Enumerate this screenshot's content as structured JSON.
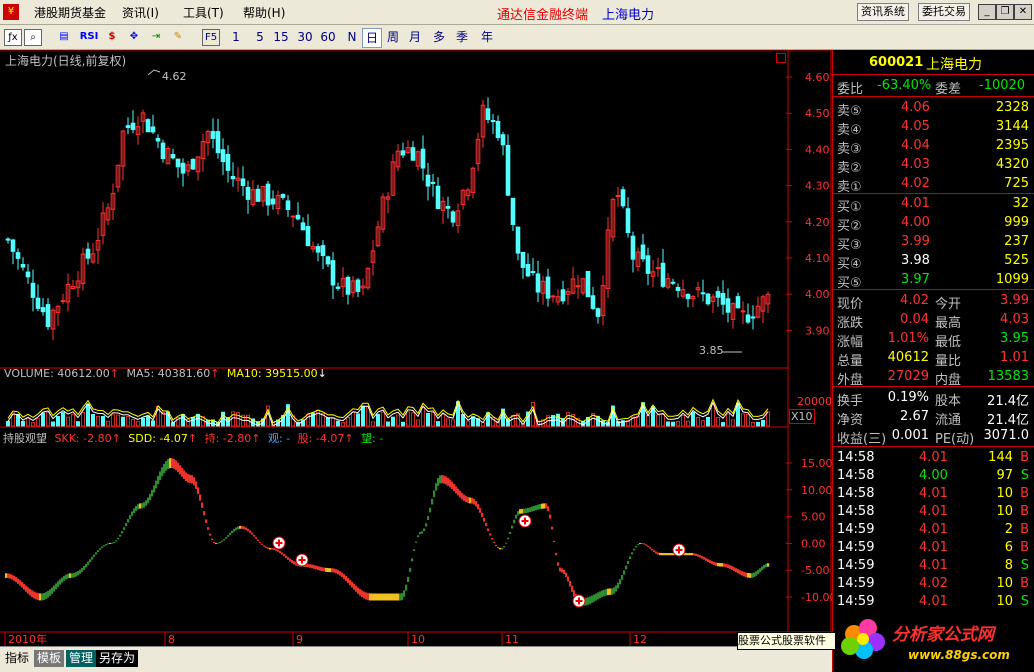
{
  "menu": {
    "items": [
      "港股期货基金",
      "资讯(I)",
      "工具(T)",
      "帮助(H)"
    ],
    "headline": "通达信金融终端",
    "headline_stock": "上海电力",
    "btn_news": "资讯系统",
    "btn_trade": "委托交易"
  },
  "toolbar": {
    "periods": [
      "1",
      "5",
      "15",
      "30",
      "60",
      "N",
      "日",
      "周",
      "月",
      "多",
      "季",
      "年"
    ],
    "selected": "日",
    "rsi_label": "RSI",
    "f5_label": "F5"
  },
  "chart": {
    "title": "上海电力(日线,前复权)",
    "price_axis": [
      "4.60",
      "4.50",
      "4.40",
      "4.30",
      "4.20",
      "4.10",
      "4.00",
      "3.90"
    ],
    "high_label": "4.62",
    "low_label": "3.85",
    "volume_legend": {
      "vol": "VOLUME: 40612.00",
      "ma5": "MA5: 40381.60",
      "ma10": "MA10: 39515.00"
    },
    "volume_axis": {
      "tick": "20000",
      "unit": "X10"
    },
    "indicator_legend": {
      "name": "持股观望",
      "skk": "SKK: -2.80",
      "sdd": "SDD: -4.07",
      "chi": "持: -2.80",
      "guan": "观: -",
      "gu": "股: -4.07",
      "wang": "望: -"
    },
    "indicator_axis": [
      "15.00",
      "10.00",
      "5.00",
      "0.00",
      "-5.00",
      "-10.00"
    ],
    "date_axis": [
      "2010年",
      "8",
      "9",
      "10",
      "11",
      "12"
    ]
  },
  "quote": {
    "code": "600021",
    "name": "上海电力",
    "weibi_label": "委比",
    "weibi": "-63.40%",
    "weicha_label": "委差",
    "weicha": "-10020",
    "sell": [
      {
        "label": "卖⑤",
        "price": "4.06",
        "vol": "2328"
      },
      {
        "label": "卖④",
        "price": "4.05",
        "vol": "3144"
      },
      {
        "label": "卖③",
        "price": "4.04",
        "vol": "2395"
      },
      {
        "label": "卖②",
        "price": "4.03",
        "vol": "4320"
      },
      {
        "label": "卖①",
        "price": "4.02",
        "vol": "725"
      }
    ],
    "buy": [
      {
        "label": "买①",
        "price": "4.01",
        "vol": "32"
      },
      {
        "label": "买②",
        "price": "4.00",
        "vol": "999"
      },
      {
        "label": "买③",
        "price": "3.99",
        "vol": "237"
      },
      {
        "label": "买④",
        "price": "3.98",
        "vol": "525"
      },
      {
        "label": "买⑤",
        "price": "3.97",
        "vol": "1099"
      }
    ],
    "stats": [
      {
        "l1": "现价",
        "v1": "4.02",
        "l2": "今开",
        "v2": "3.99"
      },
      {
        "l1": "涨跌",
        "v1": "0.04",
        "l2": "最高",
        "v2": "4.03"
      },
      {
        "l1": "涨幅",
        "v1": "1.01%",
        "l2": "最低",
        "v2": "3.95"
      },
      {
        "l1": "总量",
        "v1": "40612",
        "l2": "量比",
        "v2": "1.01"
      },
      {
        "l1": "外盘",
        "v1": "27029",
        "l2": "内盘",
        "v2": "13583"
      }
    ],
    "stats2": [
      {
        "l1": "换手",
        "v1": "0.19%",
        "l2": "股本",
        "v2": "21.4亿"
      },
      {
        "l1": "净资",
        "v1": "2.67",
        "l2": "流通",
        "v2": "21.4亿"
      },
      {
        "l1": "收益(三)",
        "v1": "0.001",
        "l2": "PE(动)",
        "v2": "3071.0"
      }
    ],
    "ticks": [
      {
        "t": "14:58",
        "p": "4.01",
        "v": "144",
        "s": "B"
      },
      {
        "t": "14:58",
        "p": "4.00",
        "v": "97",
        "s": "S"
      },
      {
        "t": "14:58",
        "p": "4.01",
        "v": "10",
        "s": "B"
      },
      {
        "t": "14:58",
        "p": "4.01",
        "v": "10",
        "s": "B"
      },
      {
        "t": "14:59",
        "p": "4.01",
        "v": "2",
        "s": "B"
      },
      {
        "t": "14:59",
        "p": "4.01",
        "v": "6",
        "s": "B"
      },
      {
        "t": "14:59",
        "p": "4.01",
        "v": "8",
        "s": "S"
      },
      {
        "t": "14:59",
        "p": "4.02",
        "v": "10",
        "s": "B"
      },
      {
        "t": "14:59",
        "p": "4.01",
        "v": "10",
        "s": "S"
      }
    ]
  },
  "bottom": {
    "tabs": [
      "指标",
      "模板",
      "管理",
      "另存为"
    ],
    "promo": "股票公式股票软件",
    "logo_text": "分析家公式网",
    "logo_url": "www.88gs.com"
  },
  "colors": {
    "up": "#ff3232",
    "down": "#54ffff",
    "bg": "#000000",
    "grid": "#8b0000",
    "sell_label": "#c0c0c0",
    "buy_price": "#ff3232"
  }
}
